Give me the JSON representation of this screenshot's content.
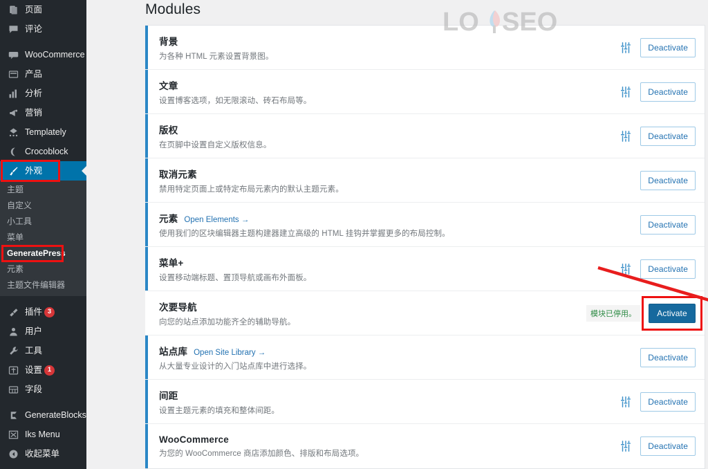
{
  "sidebar": {
    "items": [
      {
        "label": "页面",
        "icon": "pages-icon",
        "badge": null
      },
      {
        "label": "评论",
        "icon": "comments-icon",
        "badge": null
      },
      {
        "label": "WooCommerce",
        "icon": "woocommerce-icon",
        "badge": null
      },
      {
        "label": "产品",
        "icon": "products-icon",
        "badge": null
      },
      {
        "label": "分析",
        "icon": "analytics-chart-icon",
        "badge": null
      },
      {
        "label": "营销",
        "icon": "megaphone-icon",
        "badge": null
      },
      {
        "label": "Templately",
        "icon": "templately-icon",
        "badge": null
      },
      {
        "label": "Crocoblock",
        "icon": "crocoblock-moon-icon",
        "badge": null
      },
      {
        "label": "外观",
        "icon": "appearance-brush-icon",
        "badge": null,
        "current": true
      },
      {
        "label": "插件",
        "icon": "plugins-plug-icon",
        "badge": "3"
      },
      {
        "label": "用户",
        "icon": "users-icon",
        "badge": null
      },
      {
        "label": "工具",
        "icon": "tools-wrench-icon",
        "badge": null
      },
      {
        "label": "设置",
        "icon": "settings-sliders-icon",
        "badge": "1"
      },
      {
        "label": "字段",
        "icon": "fields-grid-icon",
        "badge": null
      },
      {
        "label": "GenerateBlocks",
        "icon": "generateblocks-icon",
        "badge": null
      },
      {
        "label": "Iks Menu",
        "icon": "iks-menu-icon",
        "badge": null
      },
      {
        "label": "收起菜单",
        "icon": "collapse-menu-icon",
        "badge": null
      }
    ],
    "appearance_submenu": [
      {
        "label": "主题",
        "active": false
      },
      {
        "label": "自定义",
        "active": false
      },
      {
        "label": "小工具",
        "active": false
      },
      {
        "label": "菜单",
        "active": false
      },
      {
        "label": "GeneratePress",
        "active": true
      },
      {
        "label": "元素",
        "active": false
      },
      {
        "label": "主题文件编辑器",
        "active": false
      }
    ]
  },
  "header": {
    "page_title": "Modules"
  },
  "watermark": {
    "text_left": "LO",
    "text_right": "SEO",
    "alt": "LOYSEO watermark"
  },
  "buttons": {
    "deactivate_label": "Deactivate",
    "activate_label": "Activate"
  },
  "modules": [
    {
      "title": "背景",
      "link": null,
      "description": "为各种 HTML 元素设置背景图。",
      "has_settings_icon": true,
      "status_note": null,
      "action": "Deactivate",
      "active": true
    },
    {
      "title": "文章",
      "link": null,
      "description": "设置博客选项，如无限滚动、砖石布局等。",
      "has_settings_icon": true,
      "status_note": null,
      "action": "Deactivate",
      "active": true
    },
    {
      "title": "版权",
      "link": null,
      "description": "在页脚中设置自定义版权信息。",
      "has_settings_icon": true,
      "status_note": null,
      "action": "Deactivate",
      "active": true
    },
    {
      "title": "取消元素",
      "link": null,
      "description": "禁用特定页面上或特定布局元素内的默认主题元素。",
      "has_settings_icon": false,
      "status_note": null,
      "action": "Deactivate",
      "active": true
    },
    {
      "title": "元素",
      "link": "Open Elements →",
      "description": "使用我们的区块编辑器主题构建器建立高级的 HTML 挂钩并掌握更多的布局控制。",
      "has_settings_icon": false,
      "status_note": null,
      "action": "Deactivate",
      "active": true
    },
    {
      "title": "菜单+",
      "link": null,
      "description": "设置移动端标题、置顶导航或画布外面板。",
      "has_settings_icon": true,
      "status_note": null,
      "action": "Deactivate",
      "active": true
    },
    {
      "title": "次要导航",
      "link": null,
      "description": "向您的站点添加功能齐全的辅助导航。",
      "has_settings_icon": false,
      "status_note": "模块已停用。",
      "action": "Activate",
      "active": false,
      "highlighted": true
    },
    {
      "title": "站点库",
      "link": "Open Site Library →",
      "description": "从大量专业设计的入门站点库中进行选择。",
      "has_settings_icon": false,
      "status_note": null,
      "action": "Deactivate",
      "active": true
    },
    {
      "title": "间距",
      "link": null,
      "description": "设置主题元素的填充和整体间距。",
      "has_settings_icon": true,
      "status_note": null,
      "action": "Deactivate",
      "active": true
    },
    {
      "title": "WooCommerce",
      "link": null,
      "description": "为您的 WooCommerce 商店添加颜色、排版和布局选项。",
      "has_settings_icon": true,
      "status_note": null,
      "action": "Deactivate",
      "active": true
    }
  ],
  "annotations": {
    "arrow_color": "#e81d1d",
    "highlight_color": "#ee1111",
    "accent_blue": "#0073aa",
    "activate_blue": "#16699e",
    "status_green": "#2e8b45"
  }
}
